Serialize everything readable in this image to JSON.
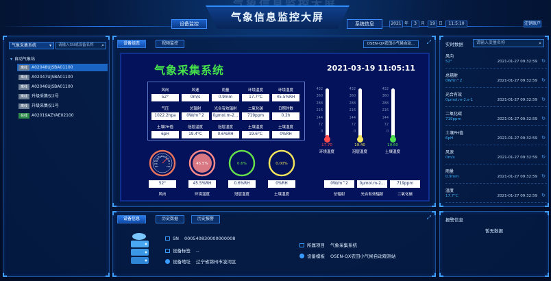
{
  "header": {
    "ghost_title": "气象信息监控大屏",
    "title": "气象信息监控大屏",
    "nav_device_monitor": "设备监控",
    "nav_system_info": "系统信息",
    "date": {
      "year": "2021",
      "year_unit": "年",
      "month": "3",
      "month_unit": "月",
      "day": "19",
      "day_unit": "日",
      "time": "11:5:10"
    },
    "logout": "注销账户"
  },
  "left": {
    "select_label": "气象采集系统",
    "search_placeholder": "请输入SN或设备名称",
    "tree_root": "自动气象站",
    "devices": [
      {
        "status": "离线",
        "name": "A02048UJSBA01100",
        "selected": true
      },
      {
        "status": "离线",
        "name": "A02047UJSBA01100",
        "selected": false
      },
      {
        "status": "离线",
        "name": "A02046UJSBA01100",
        "selected": false
      },
      {
        "status": "离线",
        "name": "升级采集仪2号",
        "selected": false
      },
      {
        "status": "离线",
        "name": "升级采集仪1号",
        "selected": false
      },
      {
        "status": "在线",
        "name": "A02019AZYAE02100",
        "selected": false
      }
    ]
  },
  "center": {
    "tab_device_status": "设备组态",
    "tab_video": "视频监控",
    "device_name": "OSEN-QX农田小气候自动...",
    "screen_title": "气象采集系统",
    "datetime": "2021-03-19 11:05:11",
    "grid": [
      [
        {
          "label": "风向",
          "value": "52°"
        },
        {
          "label": "风速",
          "value": "0m/s"
        },
        {
          "label": "雨量",
          "value": "0.9mm"
        },
        {
          "label": "环境温度",
          "value": "17.7°C"
        },
        {
          "label": "环境湿度",
          "value": "45.5%RH"
        }
      ],
      [
        {
          "label": "气压",
          "value": "1022.2hpa"
        },
        {
          "label": "总辐射",
          "value": "0W/m^2"
        },
        {
          "label": "光合有效辐射",
          "value": "0μmol.m-2..."
        },
        {
          "label": "二氧化碳",
          "value": "719ppm"
        },
        {
          "label": "日照时数",
          "value": "0.2h"
        }
      ],
      [
        {
          "label": "土壤PH值",
          "value": "6pH"
        },
        {
          "label": "冠层温度",
          "value": "19.4°C"
        },
        {
          "label": "冠层湿度",
          "value": "0.6%RH"
        },
        {
          "label": "土壤温度",
          "value": "19.6°C"
        },
        {
          "label": "土壤湿度",
          "value": "0%RH"
        }
      ]
    ],
    "thermo_scale": [
      "432",
      "360",
      "288",
      "216",
      "144",
      "72",
      "0"
    ],
    "thermometers": [
      {
        "label": "环境温度",
        "value": "17.70",
        "color": "#ff4b4b",
        "level": 0.06
      },
      {
        "label": "冠层温度",
        "value": "19.40",
        "color": "#f3e55b",
        "level": 0.06
      },
      {
        "label": "土壤温度",
        "value": "19.60",
        "color": "#4ce04c",
        "level": 0.06
      }
    ],
    "gauges": [
      {
        "label": "风向",
        "value": "52°",
        "ring_color": "#e8735a"
      },
      {
        "label": "环境湿度",
        "value": "45.5%RH",
        "ring_color": "#ff8a8a",
        "inner": "45.5%"
      },
      {
        "label": "冠层湿度",
        "value": "0.6%RH",
        "ring_color": "#66e04a",
        "inner": "0.6%"
      },
      {
        "label": "土壤湿度",
        "value": "0%RH",
        "ring_color": "#f3e55b",
        "inner": "0.00%"
      }
    ],
    "compass_ticks": [
      "104",
      "156",
      "208",
      "260",
      "312",
      "364",
      "416",
      "468",
      "52",
      "0",
      "520"
    ],
    "radiation": [
      {
        "label": "总辐射",
        "value": "0W/m^2"
      },
      {
        "label": "光合有效辐射",
        "value": "0μmol.m-2..."
      },
      {
        "label": "二氧化碳",
        "value": "719ppm"
      }
    ]
  },
  "right": {
    "title": "实时数据",
    "search_placeholder": "请输入变量名称",
    "rows": [
      {
        "name": "风向",
        "value": "52°",
        "time": "2021-01-27 09:32:59"
      },
      {
        "name": "总辐射",
        "value": "0W/m^2",
        "time": "2021-01-27 09:32:59"
      },
      {
        "name": "光合有效",
        "value": "0μmol.m-2.s-1",
        "time": "2021-01-27 09:32:59"
      },
      {
        "name": "二氧化碳",
        "value": "719ppm",
        "time": "2021-01-27 09:32:59"
      },
      {
        "name": "土壤PH值",
        "value": "6pH",
        "time": "2021-01-27 09:32:59"
      },
      {
        "name": "风速",
        "value": "0m/s",
        "time": "2021-01-27 09:32:59"
      },
      {
        "name": "雨量",
        "value": "0.9mm",
        "time": "2021-01-27 09:32:59"
      },
      {
        "name": "温度",
        "value": "17.7°C",
        "time": "2021-01-27 09:32:59"
      }
    ]
  },
  "bottom": {
    "tab_device_info": "设备信息",
    "tab_history": "历史数据",
    "tab_history_alarm": "历史报警",
    "sn_label": "SN",
    "sn_value": "000540830000000008",
    "tag_label": "设备标签",
    "tag_value": "--",
    "address_label": "设备地址",
    "address_value": "辽宁省锦州市凌河区",
    "project_label": "所属项目",
    "project_value": "气象采集系统",
    "model_label": "设备模板",
    "model_value": "OSEN-QX农田小气候自动观测站",
    "alarm_title": "报警信息",
    "alarm_empty": "暂无数据"
  }
}
